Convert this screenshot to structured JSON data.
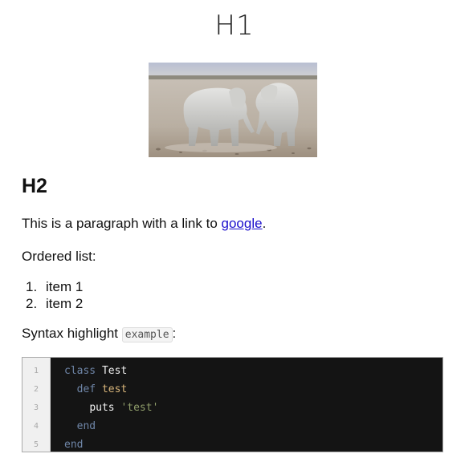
{
  "heading1": "H1",
  "image": {
    "subject": "two elephants in a dusty plain",
    "alt": ""
  },
  "heading2": "H2",
  "paragraph": {
    "text_before": "This is a paragraph with a link to ",
    "link_text": "google",
    "text_after": "."
  },
  "ordered_list": {
    "label": "Ordered list:",
    "items": [
      {
        "number": "1.",
        "text": "item 1"
      },
      {
        "number": "2.",
        "text": "item 2"
      }
    ]
  },
  "syntax": {
    "label_before": "Syntax highlight ",
    "inline_code": "example",
    "label_after": ":"
  },
  "code_block": {
    "line_numbers": [
      "1",
      "2",
      "3",
      "4",
      "5"
    ],
    "lines": [
      {
        "indent": "",
        "kw": "class",
        "sep": " ",
        "name": "Test"
      },
      {
        "indent": "  ",
        "kw": "def",
        "sep": " ",
        "name": "test"
      },
      {
        "indent": "    ",
        "plain": "puts",
        "sep": " ",
        "str": "'test'"
      },
      {
        "indent": "  ",
        "kw": "end"
      },
      {
        "indent": "",
        "kw": "end"
      }
    ],
    "colors": {
      "background": "#141414",
      "keyword": "#6f86a8",
      "method_name": "#d8b57a",
      "string": "#8f9d6a",
      "gutter": "#f0f0f0"
    }
  },
  "link_color": "#1a0dcc"
}
